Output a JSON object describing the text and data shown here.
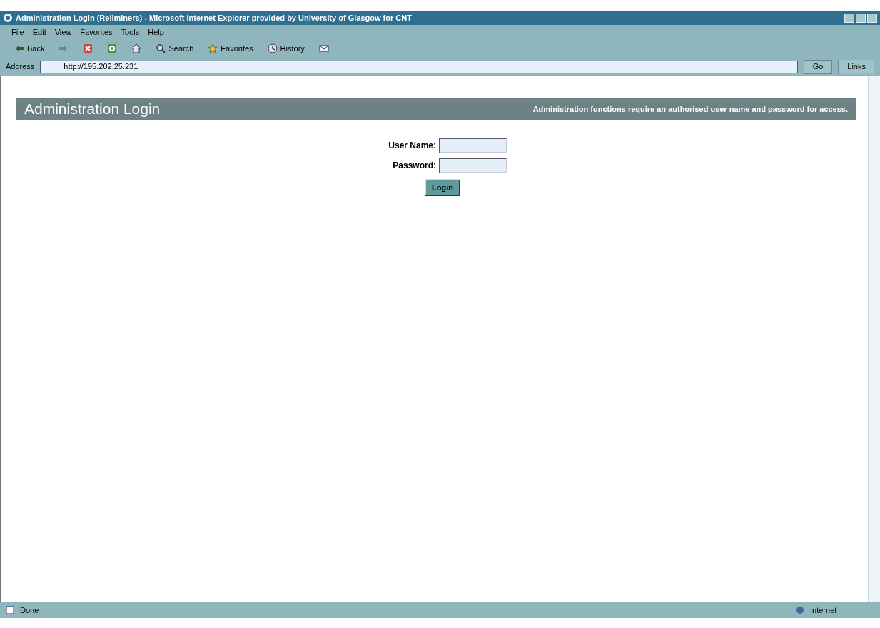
{
  "window": {
    "title": "Administration Login (Reliminers) - Microsoft Internet Explorer provided by University of Glasgow for CNT"
  },
  "menu": [
    "File",
    "Edit",
    "View",
    "Favorites",
    "Tools",
    "Help"
  ],
  "toolbar": [
    {
      "kind": "back",
      "label": "Back"
    },
    {
      "kind": "forward"
    },
    {
      "kind": "stop"
    },
    {
      "kind": "refresh"
    },
    {
      "kind": "home"
    },
    {
      "kind": "search",
      "label": "Search"
    },
    {
      "kind": "favorites",
      "label": "Favorites"
    },
    {
      "kind": "history",
      "label": "History"
    },
    {
      "kind": "mail"
    }
  ],
  "address": {
    "label": "Address",
    "value": "http://195.202.25.231",
    "go": "Go",
    "links": "Links"
  },
  "banner": {
    "title": "Administration Login",
    "note": "Administration functions require an authorised user name and password for access."
  },
  "form": {
    "fields": [
      {
        "label": "User Name:"
      },
      {
        "label": "Password:"
      }
    ],
    "button": "Login"
  },
  "status_bar": {
    "text": "Done",
    "zone": "Internet"
  }
}
